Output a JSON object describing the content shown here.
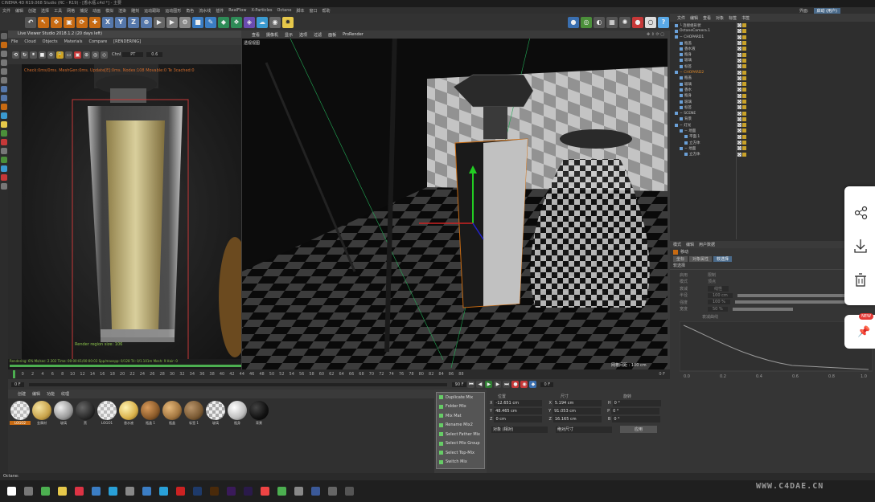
{
  "window": {
    "title": "CINEMA 4D R19.068 Studio (RC - R19) - [香水瓶.c4d *] - 主要"
  },
  "menubar": [
    "文件",
    "编辑",
    "创建",
    "选择",
    "工具",
    "网格",
    "捕捉",
    "动画",
    "模拟",
    "渲染",
    "雕刻",
    "运动跟踪",
    "运动图形",
    "角色",
    "流水线",
    "插件",
    "RealFlow",
    "X-Particles",
    "Octane",
    "脚本",
    "窗口",
    "帮助"
  ],
  "layout_label": "界面:",
  "layout_value": "启动 (用户)",
  "live_viewer": {
    "title": "Live Viewer Studio 2018.1.2 (20 days left)",
    "menu": [
      "File",
      "Cloud",
      "Objects",
      "Materials",
      "Compare",
      "[RENDERING]"
    ],
    "channel": "Chnl",
    "channel_value": "PT",
    "zoom": "0.6",
    "overlay": "Check:0ms/0ms. MeshGen:0ms. Update[E]:0ms. Nodes:108 Movable:0 Te 3cached:0",
    "region": "Render region size: 106",
    "status_lines": [
      "RTX:100% / 0% ms",
      "Out-of-core used/max:0Kb/4Gb",
      "Used/free/total vram 2.6Gb/...",
      "GSM:4.1.0 ...",
      "Rendering: 6% Ms/sec: 2.302  Time: 00:00:01/00:00:03 Spp/maxspp: 0/128  Tri: 0/1.101m  Mesh: 9  Hair: 0"
    ]
  },
  "viewport": {
    "menu": [
      "查看",
      "摄像机",
      "显示",
      "选项",
      "过滤",
      "面板",
      "ProRender"
    ],
    "camera_label": "透视视图",
    "grid_label": "网格间距 : 100 cm"
  },
  "timeline": {
    "ticks": [
      "0",
      "2",
      "4",
      "6",
      "8",
      "10",
      "12",
      "14",
      "16",
      "18",
      "20",
      "22",
      "24",
      "26",
      "28",
      "30",
      "32",
      "34",
      "36",
      "38",
      "40",
      "42",
      "44",
      "46",
      "48",
      "50",
      "52",
      "54",
      "56",
      "58",
      "60",
      "62",
      "64",
      "66",
      "68",
      "70",
      "72",
      "74",
      "76",
      "78",
      "80",
      "82",
      "84",
      "86",
      "88",
      "90"
    ],
    "current": "0 F",
    "start": "0 F",
    "end": "90 F",
    "frame_field": "0 F"
  },
  "materials": {
    "menu": [
      "创建",
      "编辑",
      "功能",
      "纹理"
    ],
    "items": [
      {
        "label": "LOGO2",
        "color": "#d8d8d8"
      },
      {
        "label": "金属材",
        "color": "#c7a24a"
      },
      {
        "label": "玻璃",
        "color": "#9a9a9a"
      },
      {
        "label": "黑",
        "color": "#2a2a2a"
      },
      {
        "label": "LOGO1",
        "color": "#e0e0e0"
      },
      {
        "label": "香水液",
        "color": "#d9b24c"
      },
      {
        "label": "瓶盖 1",
        "color": "#8a5a2a"
      },
      {
        "label": "瓶盖",
        "color": "#a27640"
      },
      {
        "label": "标签 1",
        "color": "#7a5a34"
      },
      {
        "label": "玻璃",
        "color": "#cfcfcf"
      },
      {
        "label": "瓶身",
        "color": "#bdbdbd"
      },
      {
        "label": "背景",
        "color": "#111111"
      }
    ]
  },
  "popup_menu": [
    "Duplicate Mix",
    "Folder Mix",
    "Mix Mat",
    "Rename Mix2",
    "Select Father Mix",
    "Select Mix Group",
    "Select Top-Mix",
    "Switch Mix"
  ],
  "coords": {
    "headers": [
      "位置",
      "尺寸",
      "旋转"
    ],
    "rows": [
      {
        "axis": "X",
        "pos": "-12.651 cm",
        "size": "5.194 cm",
        "rot_axis": "H",
        "rot": "0 °"
      },
      {
        "axis": "Y",
        "pos": "48.465 cm",
        "size": "91.053 cm",
        "rot_axis": "P",
        "rot": "0 °"
      },
      {
        "axis": "Z",
        "pos": "0 cm",
        "size": "16.165 cm",
        "rot_axis": "B",
        "rot": "0 °"
      }
    ],
    "mode_a": "对象 (相对)",
    "mode_b": "绝对尺寸",
    "apply": "应用"
  },
  "object_manager": {
    "menu": [
      "文件",
      "编辑",
      "查看",
      "对象",
      "标签",
      "书签"
    ],
    "rows": [
      {
        "label": "└ 连接组形状",
        "indent": 0,
        "hl": false
      },
      {
        "label": "OctaneCamera.1",
        "indent": 0,
        "hl": false
      },
      {
        "label": "− CHOPARD1",
        "indent": 0,
        "hl": false
      },
      {
        "label": "瓶盖",
        "indent": 1,
        "hl": false
      },
      {
        "label": "香水液",
        "indent": 1,
        "hl": false
      },
      {
        "label": "瓶身",
        "indent": 1,
        "hl": false
      },
      {
        "label": "玻璃",
        "indent": 1,
        "hl": false
      },
      {
        "label": "标签",
        "indent": 1,
        "hl": false
      },
      {
        "label": "− CHOPARD2",
        "indent": 0,
        "hl": true
      },
      {
        "label": "瓶盖",
        "indent": 1,
        "hl": false
      },
      {
        "label": "玻璃",
        "indent": 1,
        "hl": false
      },
      {
        "label": "香水",
        "indent": 1,
        "hl": false
      },
      {
        "label": "瓶身",
        "indent": 1,
        "hl": false
      },
      {
        "label": "玻璃",
        "indent": 1,
        "hl": false
      },
      {
        "label": "标签",
        "indent": 1,
        "hl": false
      },
      {
        "label": "− SCENE",
        "indent": 0,
        "hl": false
      },
      {
        "label": "背景",
        "indent": 1,
        "hl": false
      },
      {
        "label": "− 灯光",
        "indent": 0,
        "hl": false
      },
      {
        "label": "− 地面",
        "indent": 1,
        "hl": false
      },
      {
        "label": "平面.1",
        "indent": 2,
        "hl": false
      },
      {
        "label": "立方体",
        "indent": 2,
        "hl": false
      },
      {
        "label": "− 地面",
        "indent": 1,
        "hl": false
      },
      {
        "label": "立方体",
        "indent": 2,
        "hl": false
      }
    ]
  },
  "attributes": {
    "menu": [
      "模式",
      "编辑",
      "用户数据"
    ],
    "mode_label": "移动",
    "tabs": [
      "坐标",
      "对象属性",
      "软选择"
    ],
    "section": "软选择",
    "fields": [
      {
        "label": "启用",
        "value": "限制"
      },
      {
        "label": "模式",
        "value": "顶点"
      },
      {
        "label": "衰减",
        "value": "线性"
      },
      {
        "label": "半径",
        "value": "100 cm"
      },
      {
        "label": "强度",
        "value": "100 %"
      },
      {
        "label": "宽度",
        "value": "50 %"
      }
    ],
    "graph_title": "衰减曲线",
    "graph_ticks": [
      "0.0",
      "0.2",
      "0.4",
      "0.6",
      "0.8",
      "1.0"
    ]
  },
  "status": {
    "text": "Octane:"
  },
  "watermark": "WWW.C4DAE.CN",
  "side_panel": {
    "badge": "NEW"
  },
  "colors": {
    "accent": "#5aa9e6",
    "render_bg": "#141414",
    "selection": "#c76a12",
    "highlight": "#c63838"
  }
}
